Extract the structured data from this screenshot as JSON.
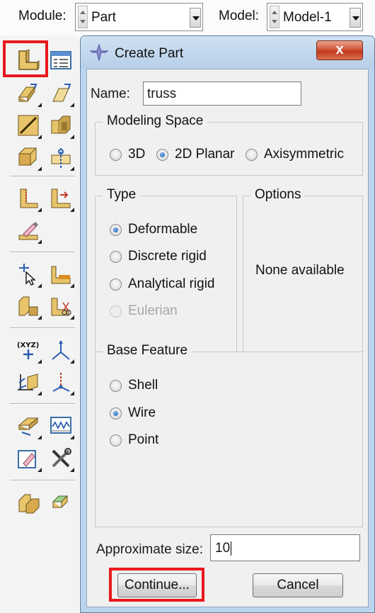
{
  "context_bar": {
    "module_label": "Module:",
    "module_value": "Part",
    "model_label": "Model:",
    "model_value": "Model-1"
  },
  "toolbox": {
    "highlight_color": "#e8191e",
    "tools": [
      "create-part-icon",
      "part-manager-icon",
      "create-solid-extrude-icon",
      "create-shell-extrude-icon",
      "create-wire-icon",
      "create-cut-extrude-icon",
      "create-solid-revolve-icon",
      "create-datum-icon",
      "create-round-fillet-icon",
      "create-chamfer-icon",
      "repair-icon",
      "query-icon",
      "partition-face-icon",
      "partition-cell-icon",
      "cut-part-icon",
      "create-datum-point-icon",
      "create-datum-axis-icon",
      "create-datum-plane-icon",
      "create-datum-csys-icon",
      "sketch-icon",
      "create-display-group-icon",
      "attribute-edit-icon",
      "tools-icon",
      "assembly-part-icon",
      "set-icon"
    ]
  },
  "dialog": {
    "title": "Create Part",
    "close_label": "x",
    "name_label": "Name:",
    "name_value": "truss",
    "modeling_space": {
      "title": "Modeling Space",
      "options": [
        "3D",
        "2D Planar",
        "Axisymmetric"
      ],
      "selected": "2D Planar"
    },
    "type": {
      "title": "Type",
      "options": [
        "Deformable",
        "Discrete rigid",
        "Analytical rigid",
        "Eulerian"
      ],
      "selected": "Deformable",
      "disabled": [
        "Eulerian"
      ]
    },
    "options_group": {
      "title": "Options",
      "text": "None available"
    },
    "base_feature": {
      "title": "Base Feature",
      "options": [
        "Shell",
        "Wire",
        "Point"
      ],
      "selected": "Wire"
    },
    "approx_size_label": "Approximate size:",
    "approx_size_value": "10",
    "continue_label": "Continue...",
    "cancel_label": "Cancel"
  },
  "colors": {
    "dialog_frame": "#bcd5ee",
    "close_button": "#c1391c",
    "radio_selected": "#1f5fae"
  }
}
